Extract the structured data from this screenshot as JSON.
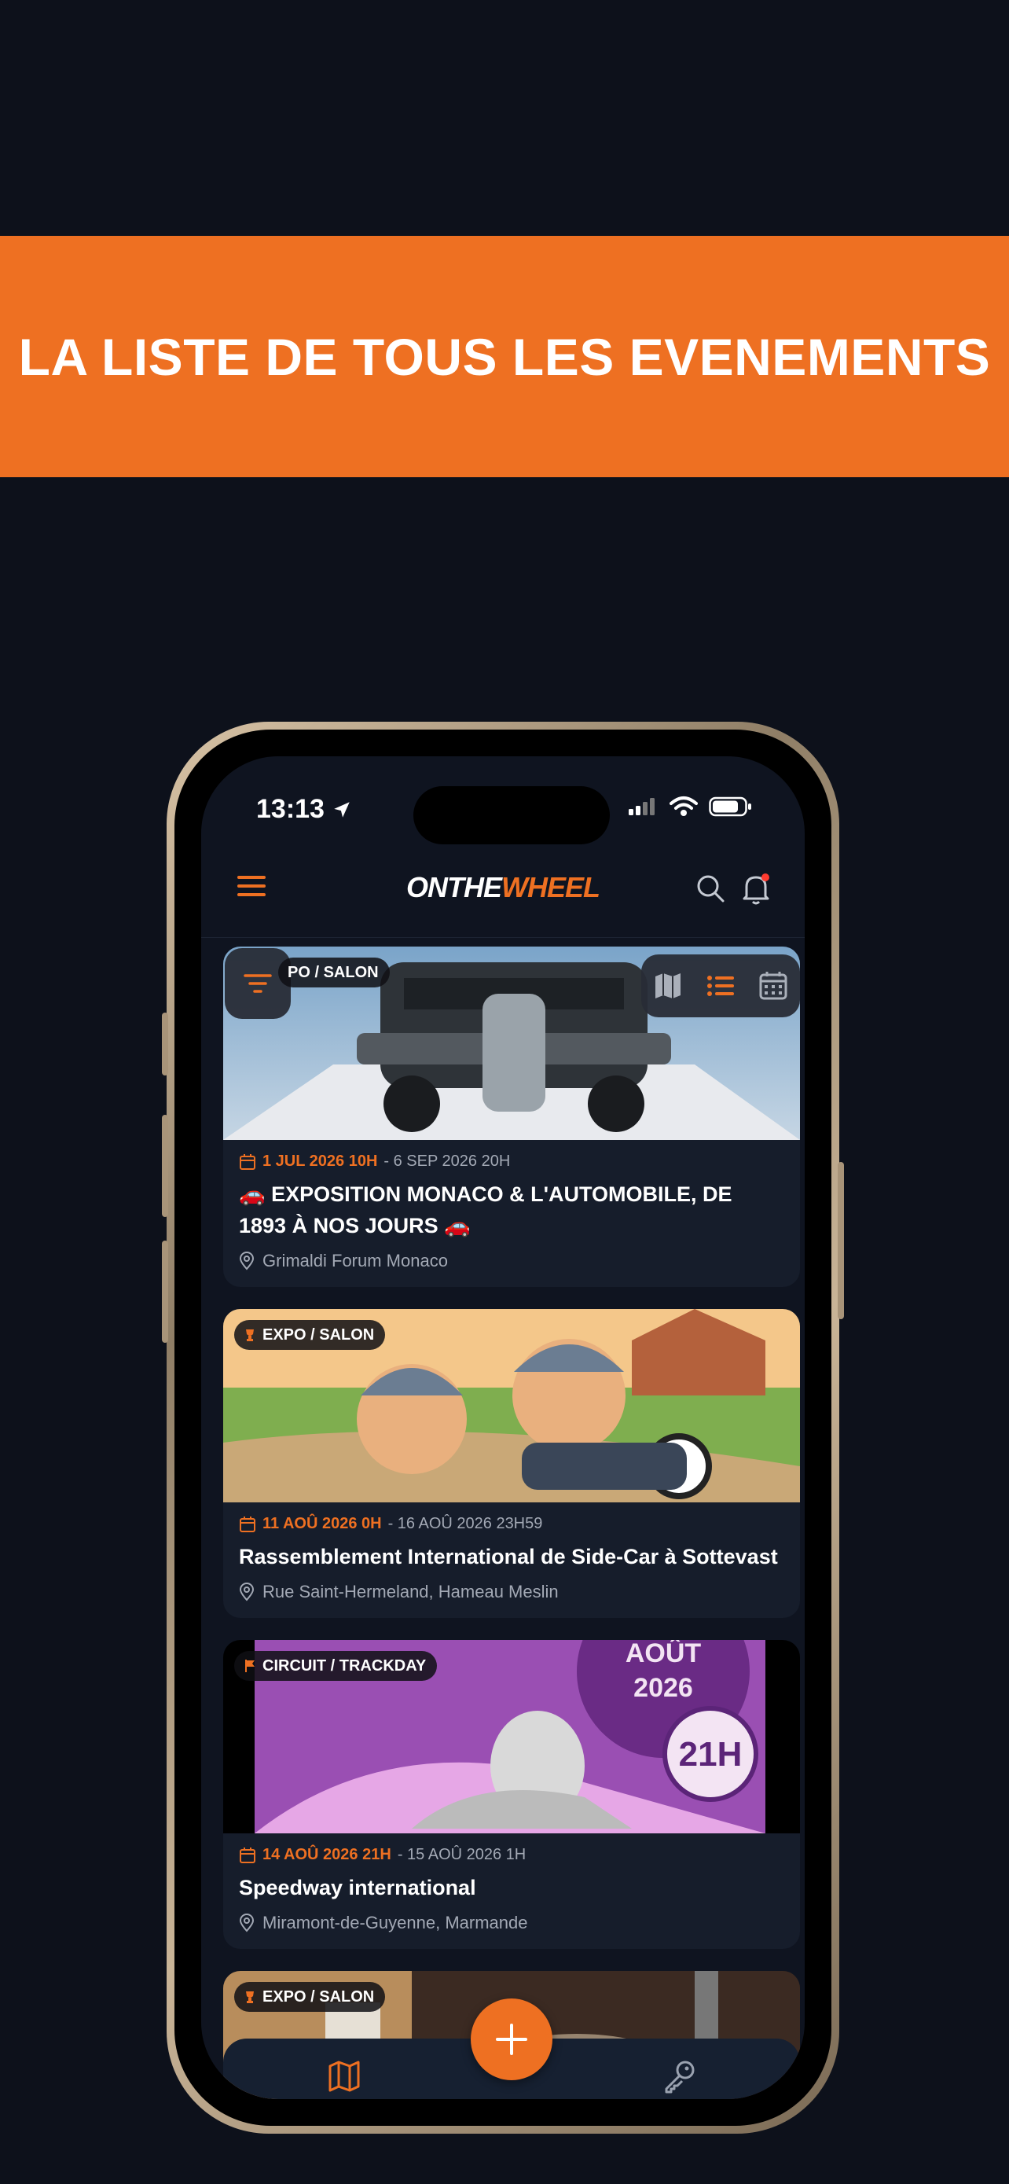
{
  "banner": {
    "text": "LA LISTE DE TOUS LES EVENEMENTS"
  },
  "status_bar": {
    "time": "13:13"
  },
  "app": {
    "logo_part1": "ONTHE",
    "logo_part2": "WHEEL",
    "accent": "#ee7022"
  },
  "events": [
    {
      "category": "PO / SALON",
      "date_start": "1 JUL 2026 10H",
      "date_end": "- 6 SEP 2026 20H",
      "title": "🚗 EXPOSITION MONACO & L'AUTOMOBILE, DE 1893 À NOS JOURS 🚗",
      "location": "Grimaldi Forum Monaco"
    },
    {
      "category": "EXPO / SALON",
      "date_start": "11 AOÛ 2026 0H",
      "date_end": "- 16 AOÛ 2026 23H59",
      "title": "Rassemblement International de Side-Car à Sottevast",
      "location": "Rue Saint-Hermeland,  Hameau Meslin"
    },
    {
      "category": "CIRCUIT / TRACKDAY",
      "date_start": "14 AOÛ 2026 21H",
      "date_end": "- 15 AOÛ 2026 1H",
      "title": "Speedway international",
      "location": "Miramont-de-Guyenne,  Marmande",
      "poster_line1": "AOÛT",
      "poster_line2": "2026",
      "poster_time": "21H"
    },
    {
      "category": "EXPO / SALON"
    }
  ]
}
